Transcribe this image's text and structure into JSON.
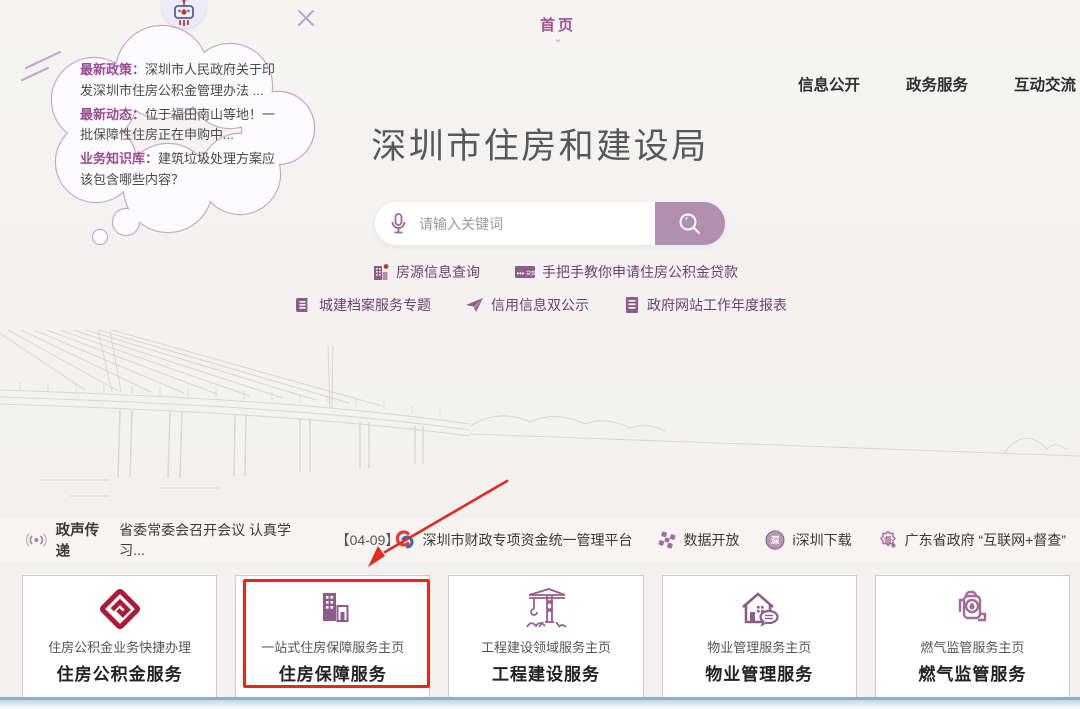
{
  "assistant_bubble": {
    "items": [
      {
        "label": "最新政策：",
        "text": "深圳市人民政府关于印发深圳市住房公积金管理办法 ..."
      },
      {
        "label": "最新动态：",
        "text": "位于福田南山等地！一批保障性住房正在申购中..."
      },
      {
        "label": "业务知识库：",
        "text": "建筑垃圾处理方案应该包含哪些内容？"
      }
    ]
  },
  "top_nav": {
    "home_label": "首页",
    "items": [
      {
        "label": "信息公开"
      },
      {
        "label": "政务服务"
      },
      {
        "label": "互动交流"
      }
    ]
  },
  "hero": {
    "site_title": "深圳市住房和建设局"
  },
  "search": {
    "placeholder": "请输入关键词"
  },
  "quick_links": {
    "row1": [
      {
        "label": "房源信息查询"
      },
      {
        "label": "手把手教你申请住房公积金贷款",
        "icon_text": "贷款"
      }
    ],
    "row2": [
      {
        "label": "城建档案服务专题"
      },
      {
        "label": "信用信息双公示"
      },
      {
        "label": "政府网站工作年度报表"
      }
    ]
  },
  "notice_bar": {
    "program_label": "政声传递",
    "headline": "省委常委会召开会议 认真学习...",
    "date": "【04-09】",
    "links": [
      {
        "label": "深圳市财政专项资金统一管理平台"
      },
      {
        "label": "数据开放"
      },
      {
        "label": "i深圳下载",
        "icon_text": "深"
      },
      {
        "label": "广东省政府 “互联网+督查”",
        "icon_text": "督"
      }
    ]
  },
  "service_cards": [
    {
      "subtitle": "住房公积金业务快捷办理",
      "title": "住房公积金服务"
    },
    {
      "subtitle": "一站式住房保障服务主页",
      "title": "住房保障服务",
      "highlighted": true
    },
    {
      "subtitle": "工程建设领域服务主页",
      "title": "工程建设服务"
    },
    {
      "subtitle": "物业管理服务主页",
      "title": "物业管理服务"
    },
    {
      "subtitle": "燃气监管服务主页",
      "title": "燃气监管服务"
    }
  ],
  "colors": {
    "accent_purple": "#a5779f",
    "search_button_purple": "#b18fae",
    "deep_purple_text": "#6e3f74",
    "bubble_label_purple": "#9a4b92",
    "brand_red": "#b11e3c",
    "annotation_red": "#e8281e",
    "title_gray": "#585858",
    "bottom_bar_blue": "#8fafc3"
  }
}
